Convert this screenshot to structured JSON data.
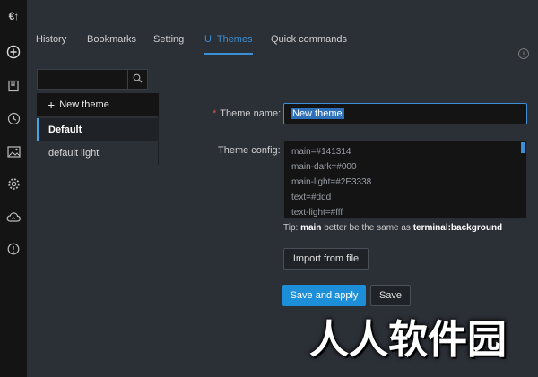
{
  "sidebar": {
    "logo": "€↑",
    "icons": [
      "plus-circle-icon",
      "bookmark-icon",
      "clock-icon",
      "image-icon",
      "gear-icon",
      "cloud-sync-icon",
      "info-icon"
    ]
  },
  "tabs": [
    {
      "label": "History",
      "active": false
    },
    {
      "label": "Bookmarks",
      "active": false
    },
    {
      "label": "Setting",
      "active": false
    },
    {
      "label": "UI Themes",
      "active": true
    },
    {
      "label": "Quick commands",
      "active": false
    }
  ],
  "search": {
    "placeholder": "",
    "value": ""
  },
  "theme_list": {
    "new_theme_label": "New theme",
    "items": [
      {
        "label": "Default",
        "active": true
      },
      {
        "label": "default light",
        "active": false
      }
    ]
  },
  "form": {
    "required_mark": "*",
    "name_label": "Theme name:",
    "name_value": "New theme",
    "config_label": "Theme config:",
    "config_lines": [
      "main=#141314",
      "main-dark=#000",
      "main-light=#2E3338",
      "text=#ddd",
      "text-light=#fff"
    ],
    "tip": {
      "prefix": "Tip: ",
      "bold1": "main",
      "middle": " better be the same as ",
      "bold2": "terminal:background"
    },
    "import_label": "Import from file",
    "save_apply_label": "Save and apply",
    "save_label": "Save"
  },
  "watermark": "人人软件园",
  "colors": {
    "accent": "#3a8fd6",
    "primary_button": "#1d8fd8",
    "background": "#2b2f36",
    "sidebar": "#141414",
    "required": "#e0503c"
  }
}
